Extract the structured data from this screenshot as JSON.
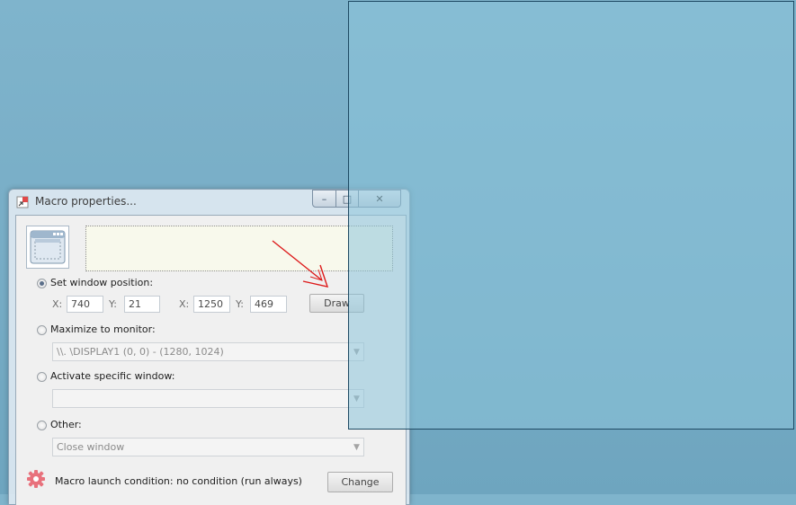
{
  "window": {
    "title": "Macro properties...",
    "controls": {
      "minimize": "–",
      "maximize": "□",
      "close": "✕"
    }
  },
  "description": {
    "text": ""
  },
  "set_position": {
    "label": "Set window position:",
    "checked": true,
    "x1_label": "X:",
    "x1": "740",
    "y1_label": "Y:",
    "y1": "21",
    "x2_label": "X:",
    "x2": "1250",
    "y2_label": "Y:",
    "y2": "469",
    "draw_button": "Draw"
  },
  "maximize": {
    "label": "Maximize to monitor:",
    "checked": false,
    "selected": "\\\\. \\DISPLAY1 (0, 0) - (1280, 1024)"
  },
  "activate": {
    "label": "Activate specific window:",
    "checked": false,
    "selected": ""
  },
  "other": {
    "label": "Other:",
    "checked": false,
    "selected": "Close window"
  },
  "launch": {
    "label": "Macro launch condition: no condition (run always)",
    "change_button": "Change"
  },
  "icons": {
    "app": "window-icon",
    "big": "window-icon",
    "gear": "gear-icon",
    "combo_arrow": "chevron-down-icon"
  },
  "colors": {
    "desktop": "#78adc6",
    "selection_border": "#1e4a63",
    "arrow": "#dd1a1a",
    "gear": "#e8717c",
    "description_bg": "#f8f9ec"
  }
}
